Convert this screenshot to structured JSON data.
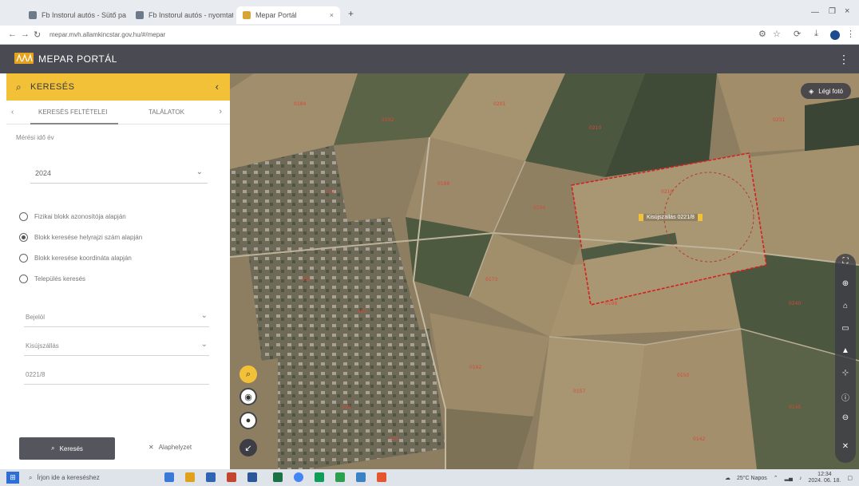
{
  "browser": {
    "tabs": [
      {
        "label": "Fb Instorul autós - Sütő papír"
      },
      {
        "label": "Fb Instorul autós - nyomtatás"
      },
      {
        "label": "Mepar Portál"
      }
    ],
    "new_tab": "+",
    "url": "mepar.mvh.allamkincstar.gov.hu/#/mepar"
  },
  "app": {
    "title": "MEPAR PORTÁL",
    "menu_icon": "more-vertical-icon"
  },
  "sidebar": {
    "search_title": "KERESÉS",
    "tabs": [
      {
        "label": "KERESÉS FELTÉTELEI"
      },
      {
        "label": "TALÁLATOK"
      }
    ],
    "year_label": "Mérési idő év",
    "year_value": "2024",
    "radio_options": [
      {
        "label": "Fizikai blokk azonosítója alapján",
        "selected": false
      },
      {
        "label": "Blokk keresése helyrajzi szám alapján",
        "selected": true
      },
      {
        "label": "Blokk keresése koordináta alapján",
        "selected": false
      },
      {
        "label": "Település keresés",
        "selected": false
      }
    ],
    "fields": [
      {
        "value": "Bejelöl",
        "has_chevron": true
      },
      {
        "value": "Kisújszállás",
        "has_chevron": true
      },
      {
        "value": "0221/8",
        "has_chevron": false
      }
    ],
    "search_button": "Keresés",
    "clear_button": "Alaphelyzet"
  },
  "map": {
    "base_layer_label": "Légi fotó",
    "parcel_label": "Kisújszállás 0221/8",
    "left_tools": [
      "search-icon",
      "layers-icon",
      "location-icon",
      "collapse-icon"
    ],
    "right_tools": [
      "fullscreen-icon",
      "zoom-in-icon",
      "home-icon",
      "ruler-icon",
      "north-arrow-icon",
      "crosshair-icon",
      "info-icon",
      "zoom-out-icon",
      "close-icon"
    ]
  },
  "taskbar": {
    "search_placeholder": "Írjon ide a kereséshez",
    "weather": "25°C Napos",
    "time": "12:34",
    "date": "2024. 06. 18."
  },
  "colors": {
    "accent": "#f3c138",
    "header": "#4a4a52",
    "parcel_outline": "#d42020"
  }
}
